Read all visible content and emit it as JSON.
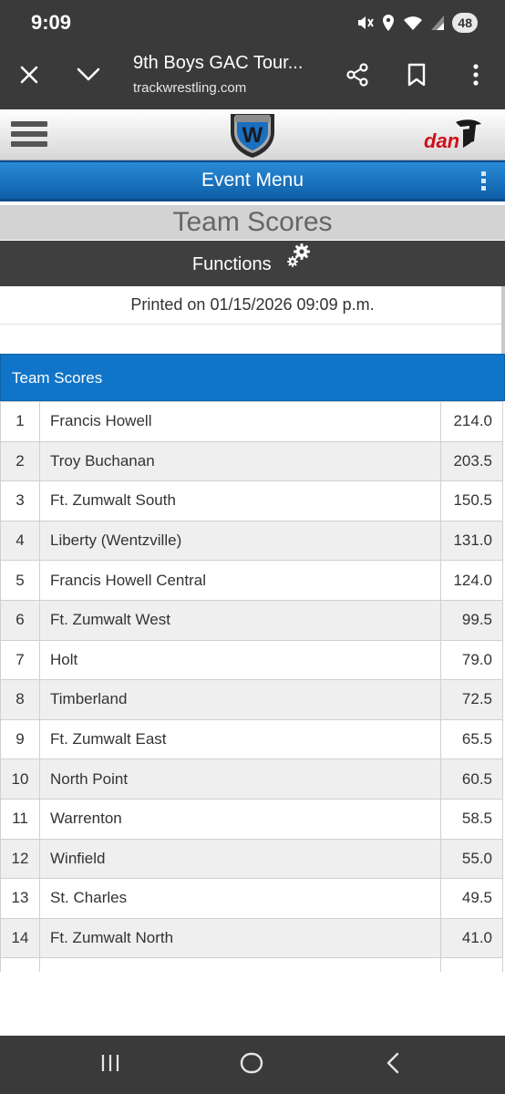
{
  "status_bar": {
    "time": "9:09",
    "battery": "48",
    "icons": [
      "mute-icon",
      "location-icon",
      "wifi-icon",
      "signal-icon"
    ]
  },
  "browser": {
    "tab_title": "9th Boys GAC Tour...",
    "url": "trackwrestling.com",
    "icons": [
      "close-icon",
      "chevron-down-icon",
      "share-icon",
      "bookmark-icon",
      "more-vert-icon"
    ]
  },
  "site": {
    "logo_letter": "W",
    "brand_text": "dan"
  },
  "event_menu": {
    "label": "Event Menu"
  },
  "page_title": "Team Scores",
  "functions": {
    "label": "Functions"
  },
  "printed_on": "Printed on 01/15/2026 09:09 p.m.",
  "team_scores": {
    "header": "Team Scores",
    "rows": [
      {
        "rank": "1",
        "team": "Francis Howell",
        "score": "214.0"
      },
      {
        "rank": "2",
        "team": "Troy Buchanan",
        "score": "203.5"
      },
      {
        "rank": "3",
        "team": "Ft. Zumwalt South",
        "score": "150.5"
      },
      {
        "rank": "4",
        "team": "Liberty (Wentzville)",
        "score": "131.0"
      },
      {
        "rank": "5",
        "team": "Francis Howell Central",
        "score": "124.0"
      },
      {
        "rank": "6",
        "team": "Ft. Zumwalt West",
        "score": "99.5"
      },
      {
        "rank": "7",
        "team": "Holt",
        "score": "79.0"
      },
      {
        "rank": "8",
        "team": "Timberland",
        "score": "72.5"
      },
      {
        "rank": "9",
        "team": "Ft. Zumwalt East",
        "score": "65.5"
      },
      {
        "rank": "10",
        "team": "North Point",
        "score": "60.5"
      },
      {
        "rank": "11",
        "team": "Warrenton",
        "score": "58.5"
      },
      {
        "rank": "12",
        "team": "Winfield",
        "score": "55.0"
      },
      {
        "rank": "13",
        "team": "St. Charles",
        "score": "49.5"
      },
      {
        "rank": "14",
        "team": "Ft. Zumwalt North",
        "score": "41.0"
      },
      {
        "rank": "",
        "team": "",
        "score": ""
      }
    ]
  },
  "colors": {
    "system_bar": "#3a3a3a",
    "accent_blue": "#1075c8",
    "functions_bar": "#3f3f3f",
    "title_bar": "#d3d3d3",
    "brand_red": "#d0101a"
  },
  "nav": {
    "icons": [
      "recents-icon",
      "home-icon",
      "back-icon"
    ]
  }
}
